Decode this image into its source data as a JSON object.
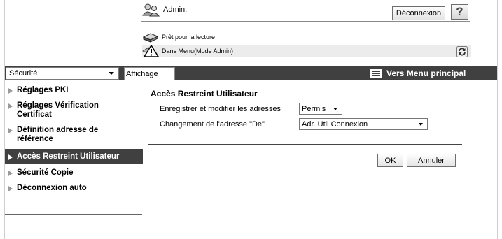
{
  "header": {
    "user_label": "Admin.",
    "logout_label": "Déconnexion",
    "help_label": "?",
    "status_ready": "Prêt pour la lecture",
    "status_mode": "Dans Menu(Mode Admin)"
  },
  "menubar": {
    "section_select": "Sécurité",
    "tab_label": "Affichage",
    "main_menu_label": "Vers Menu principal"
  },
  "sidebar": {
    "items": [
      {
        "label": "Réglages PKI",
        "active": false
      },
      {
        "label": "Réglages Vérification Certificat",
        "active": false
      },
      {
        "label": "Définition adresse de référence",
        "active": false
      },
      {
        "label": "Accès Restreint Utilisateur",
        "active": true
      },
      {
        "label": "Sécurité Copie",
        "active": false
      },
      {
        "label": "Déconnexion auto",
        "active": false
      }
    ]
  },
  "main": {
    "title": "Accès Restreint Utilisateur",
    "rows": [
      {
        "label": "Enregistrer et modifier les adresses",
        "value": "Permis"
      },
      {
        "label": "Changement de l'adresse \"De\"",
        "value": "Adr. Util Connexion"
      }
    ],
    "ok_label": "OK",
    "cancel_label": "Annuler"
  },
  "icons": {
    "user": "admin-user-icon",
    "ready": "printer-icon",
    "mode": "warning-icon",
    "refresh": "refresh-icon",
    "menu": "menu-icon"
  },
  "colors": {
    "menubar": "#404040",
    "active_item": "#404040",
    "status_bg": "#ececec"
  }
}
